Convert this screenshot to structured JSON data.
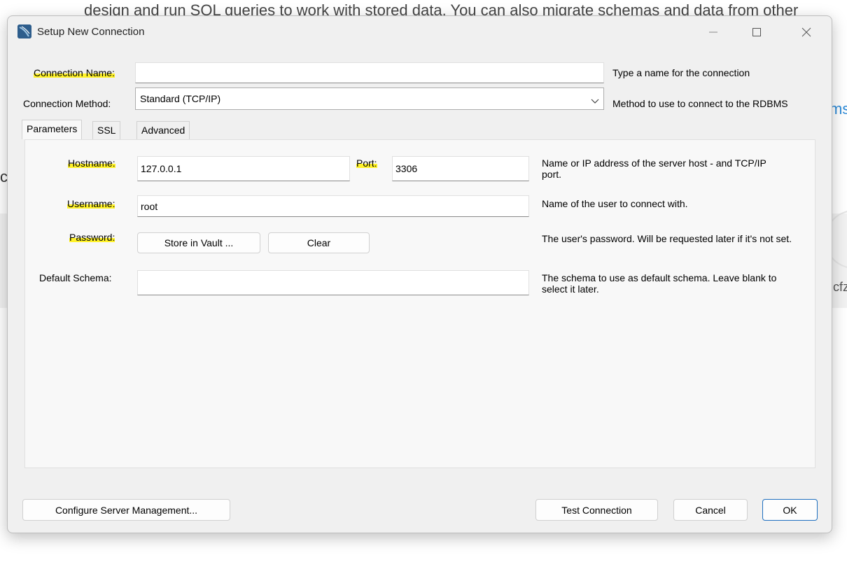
{
  "background": {
    "text_line": "design and run SQL queries to work with stored data. You can also migrate schemas and data from other",
    "link_fragment": "ms",
    "left_fragment": "c",
    "right_fragment": "cfz"
  },
  "dialog": {
    "title": "Setup New Connection",
    "app_icon": "mysql-workbench-icon",
    "window_controls": [
      "minimize-icon",
      "maximize-icon",
      "close-icon"
    ]
  },
  "connection": {
    "name_label": "Connection Name:",
    "name_value": "",
    "name_hint": "Type a name for the connection",
    "method_label": "Connection Method:",
    "method_value": "Standard (TCP/IP)",
    "method_hint": "Method to use to connect to the RDBMS"
  },
  "tabs": [
    {
      "label": "Parameters",
      "active": true
    },
    {
      "label": "SSL",
      "active": false
    },
    {
      "label": "Advanced",
      "active": false
    }
  ],
  "parameters": {
    "hostname_label": "Hostname:",
    "hostname_value": "127.0.0.1",
    "port_label": "Port:",
    "port_value": "3306",
    "host_hint": "Name or IP address of the server host - and TCP/IP port.",
    "username_label": "Username:",
    "username_value": "root",
    "username_hint": "Name of the user to connect with.",
    "password_label": "Password:",
    "store_vault_button": "Store in Vault ...",
    "clear_button": "Clear",
    "password_hint": "The user's password. Will be requested later if it's not set.",
    "schema_label": "Default Schema:",
    "schema_value": "",
    "schema_hint": "The schema to use as default schema. Leave blank to select it later."
  },
  "footer": {
    "configure_button": "Configure Server Management...",
    "test_button": "Test Connection",
    "cancel_button": "Cancel",
    "ok_button": "OK"
  },
  "colors": {
    "highlight": "#fff22a",
    "link": "#2b8ad8",
    "ok_border": "#1f6fbf"
  }
}
